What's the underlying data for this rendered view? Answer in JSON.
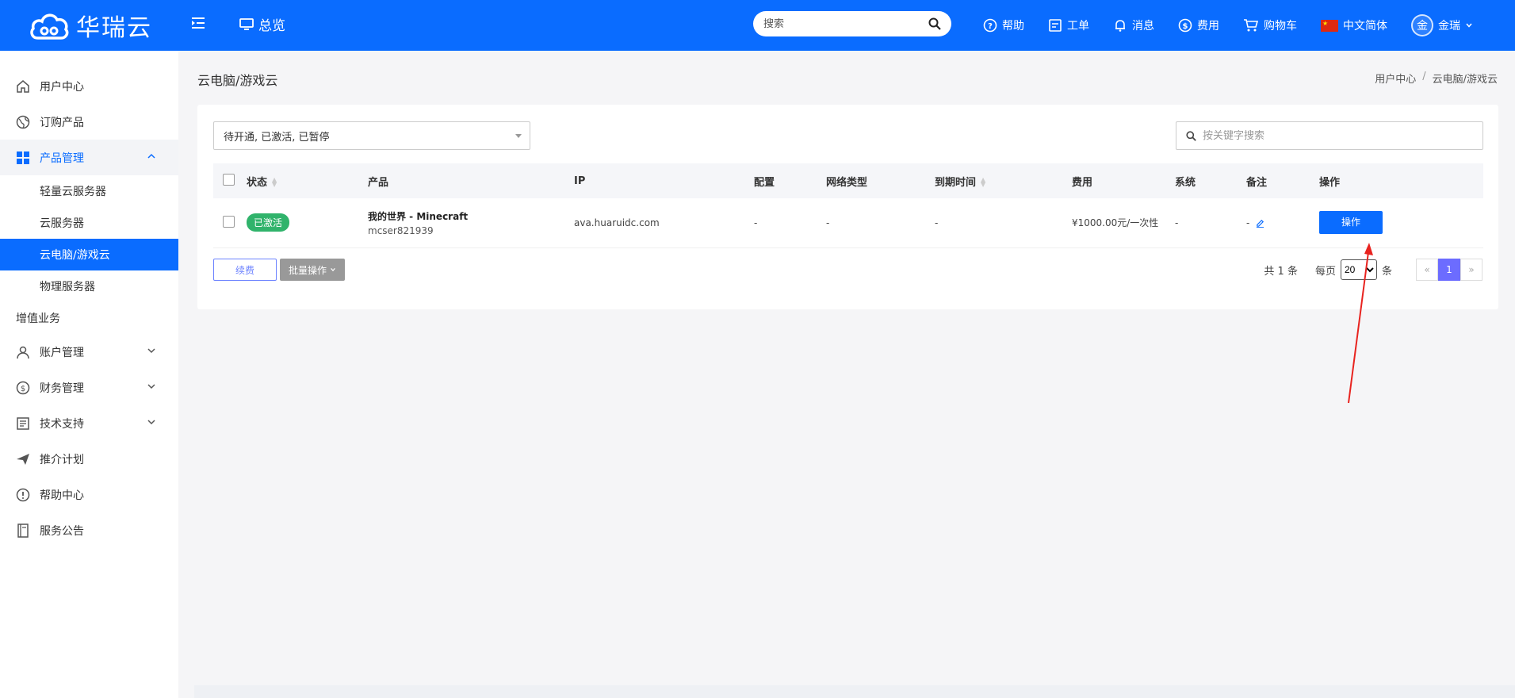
{
  "brand": {
    "name": "华瑞云",
    "accent": "#0a6cff"
  },
  "topbar": {
    "overview": "总览",
    "search_placeholder": "搜索",
    "links": [
      {
        "label": "帮助",
        "icon": "help-icon"
      },
      {
        "label": "工单",
        "icon": "ticket-icon"
      },
      {
        "label": "消息",
        "icon": "bell-icon"
      },
      {
        "label": "费用",
        "icon": "dollar-icon"
      },
      {
        "label": "购物车",
        "icon": "cart-icon"
      },
      {
        "label": "中文简体",
        "icon": "china-flag-icon"
      }
    ],
    "user": {
      "avatar_text": "金",
      "name": "金瑞"
    }
  },
  "sidebar": {
    "items": [
      {
        "label": "用户中心"
      },
      {
        "label": "订购产品"
      },
      {
        "label": "产品管理"
      }
    ],
    "product_sub": [
      "轻量云服务器",
      "云服务器",
      "云电脑/游戏云",
      "物理服务器"
    ],
    "section": "增值业务",
    "more": [
      {
        "label": "账户管理"
      },
      {
        "label": "财务管理"
      },
      {
        "label": "技术支持"
      },
      {
        "label": "推介计划"
      },
      {
        "label": "帮助中心"
      },
      {
        "label": "服务公告"
      }
    ]
  },
  "page": {
    "title": "云电脑/游戏云",
    "breadcrumb": [
      "用户中心",
      "云电脑/游戏云"
    ]
  },
  "filters": {
    "status_value": "待开通, 已激活, 已暂停",
    "keyword_placeholder": "按关键字搜索"
  },
  "table": {
    "headers": [
      "状态",
      "产品",
      "IP",
      "配置",
      "网络类型",
      "到期时间",
      "费用",
      "系统",
      "备注",
      "操作"
    ],
    "rows": [
      {
        "status": "已激活",
        "product_name": "我的世界 - Minecraft",
        "product_sub": "mcser821939",
        "ip": "ava.huaruidc.com",
        "config": "-",
        "network": "-",
        "expire": "-",
        "fee": "¥1000.00元/一次性",
        "system": "-",
        "note": "-",
        "action": "操作"
      }
    ]
  },
  "actions": {
    "renew": "续费",
    "batch": "批量操作"
  },
  "pager": {
    "total": "共 1 条",
    "per_page_label": "每页",
    "per_page_value": "20",
    "per_page_unit": "条",
    "prev": "«",
    "current": "1",
    "next": "»"
  }
}
